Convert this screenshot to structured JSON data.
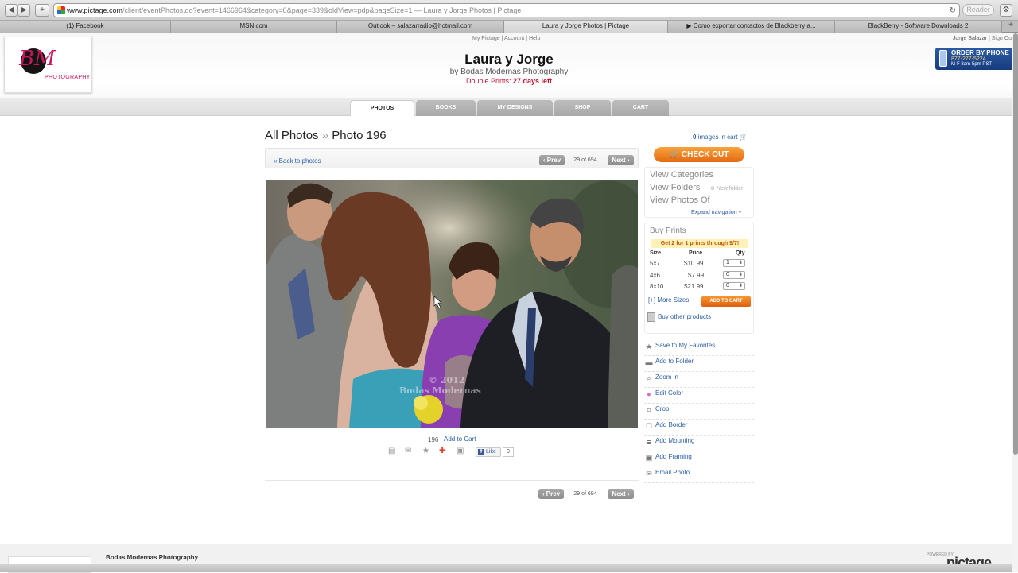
{
  "browser": {
    "url_host": "www.pictage.com",
    "url_path": "/client/eventPhotos.do?event=1466964&category=0&page=339&oldView=pdp&pageSize=1",
    "url_title": "— Laura y Jorge Photos | Pictage",
    "reader_label": "Reader",
    "tabs": [
      {
        "label": "(1) Facebook"
      },
      {
        "label": "MSN.com"
      },
      {
        "label": "Outlook – salazarradio@hotmail.com"
      },
      {
        "label": "Laura y Jorge Photos | Pictage"
      },
      {
        "label": "▶ Como exportar contactos de Blackberry a..."
      },
      {
        "label": "BlackBerry - Software Downloads 2"
      }
    ]
  },
  "header": {
    "logo_text": "PHOTOGRAPHY",
    "top_links": [
      "My Pictage",
      "Account",
      "Help"
    ],
    "user_name": "Jorge Salazar",
    "sign_out": "Sign Out",
    "album_title": "Laura y Jorge",
    "album_subtitle": "by Bodas Modernas Photography",
    "double_prints_label": "Double Prints:",
    "double_prints_days": "27 days left",
    "phone": {
      "line1": "ORDER BY PHONE",
      "line2": "877-277-5224",
      "line3": "M-F 8am-5pm PST"
    },
    "nav_tabs": [
      "PHOTOS",
      "BOOKS",
      "MY DESIGNS",
      "SHOP",
      "CART"
    ]
  },
  "content": {
    "crumb_all": "All Photos",
    "crumb_sep": "»",
    "crumb_current": "Photo 196",
    "back_link": "« Back to photos",
    "prev": "‹ Prev",
    "next": "Next ›",
    "page_count": "29 of 694",
    "photo_number": "196",
    "add_to_cart": "Add to Cart",
    "fb_like": "Like",
    "fb_count": "0"
  },
  "sidebar": {
    "cart_count": "0",
    "cart_label": "images in cart",
    "checkout": "CHECK OUT",
    "view_categories": "View Categories",
    "view_folders": "View Folders",
    "new_folder": "New folder",
    "view_photos_of": "View Photos Of",
    "expand_nav": "Expand navigation",
    "buy_prints": "Buy Prints",
    "promo": "Get 2 for 1 prints through 9/7!",
    "col_size": "Size",
    "col_price": "Price",
    "col_qty": "Qty.",
    "prints": [
      {
        "size": "5x7",
        "price": "$10.99",
        "qty": "1"
      },
      {
        "size": "4x6",
        "price": "$7.99",
        "qty": "0"
      },
      {
        "size": "8x10",
        "price": "$21.99",
        "qty": "0"
      }
    ],
    "more_sizes": "[+] More Sizes",
    "add_to_cart_btn": "ADD TO CART",
    "buy_other": "Buy other products",
    "actions": [
      "Save to My Favorites",
      "Add to Folder",
      "Zoom in",
      "Edit Color",
      "Crop",
      "Add Border",
      "Add Mounting",
      "Add Framing",
      "Email Photo"
    ]
  },
  "footer": {
    "studio": "Bodas Modernas Photography",
    "powered": "POWERED BY",
    "brand": "pictage"
  }
}
